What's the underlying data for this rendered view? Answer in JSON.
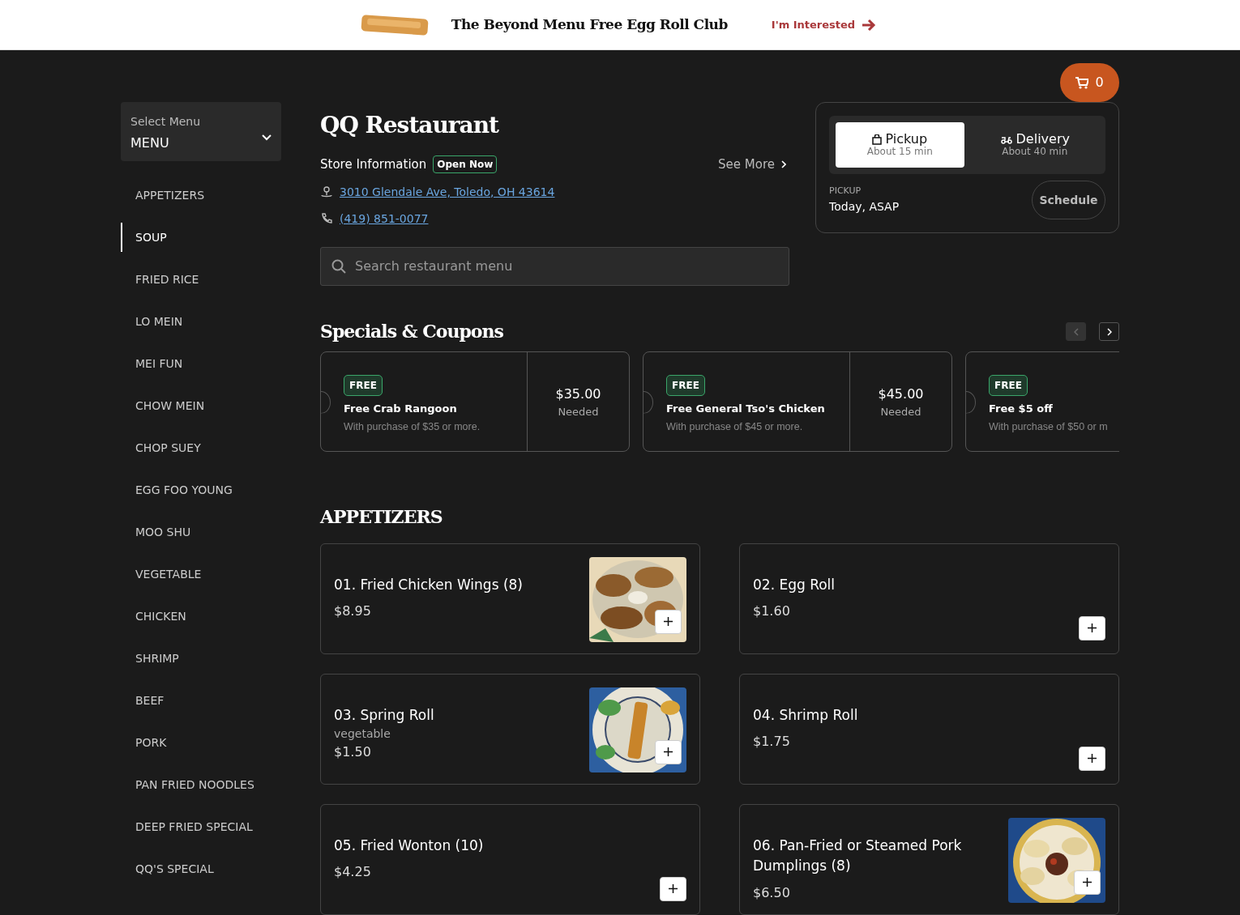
{
  "banner": {
    "title": "The Beyond Menu Free Egg Roll Club",
    "action": "I'm Interested"
  },
  "cart": {
    "count": "0"
  },
  "sidebar": {
    "select_label": "Select Menu",
    "select_value": "MENU",
    "items": [
      {
        "label": "APPETIZERS",
        "selected": false
      },
      {
        "label": "SOUP",
        "selected": true
      },
      {
        "label": "FRIED RICE",
        "selected": false
      },
      {
        "label": "LO MEIN",
        "selected": false
      },
      {
        "label": "MEI FUN",
        "selected": false
      },
      {
        "label": "CHOW MEIN",
        "selected": false
      },
      {
        "label": "CHOP SUEY",
        "selected": false
      },
      {
        "label": "EGG FOO YOUNG",
        "selected": false
      },
      {
        "label": "MOO SHU",
        "selected": false
      },
      {
        "label": "VEGETABLE",
        "selected": false
      },
      {
        "label": "CHICKEN",
        "selected": false
      },
      {
        "label": "SHRIMP",
        "selected": false
      },
      {
        "label": "BEEF",
        "selected": false
      },
      {
        "label": "PORK",
        "selected": false
      },
      {
        "label": "PAN FRIED NOODLES",
        "selected": false
      },
      {
        "label": "DEEP FRIED SPECIAL",
        "selected": false
      },
      {
        "label": "QQ'S SPECIAL",
        "selected": false
      }
    ]
  },
  "restaurant": {
    "name": "QQ Restaurant",
    "store_info": "Store Information",
    "status": "Open Now",
    "see_more": "See More",
    "address": "3010 Glendale Ave, Toledo, OH 43614",
    "phone": "(419) 851-0077"
  },
  "search": {
    "placeholder": "Search restaurant menu"
  },
  "order": {
    "modes": [
      {
        "kind": "pickup",
        "label": "Pickup",
        "time": "About 15 min",
        "selected": true
      },
      {
        "kind": "delivery",
        "label": "Delivery",
        "time": "About 40 min",
        "selected": false
      }
    ],
    "when_label": "PICKUP",
    "when": "Today, ASAP",
    "schedule": "Schedule"
  },
  "specials": {
    "title": "Specials & Coupons",
    "prev_disabled": true,
    "coupons": [
      {
        "tag": "FREE",
        "title": "Free Crab Rangoon",
        "desc": "With purchase of $35 or more.",
        "amount": "$35.00",
        "needed": "Needed"
      },
      {
        "tag": "FREE",
        "title": "Free General Tso's Chicken",
        "desc": "With purchase of $45 or more.",
        "amount": "$45.00",
        "needed": "Needed"
      },
      {
        "tag": "FREE",
        "title": "Free $5 off",
        "desc": "With purchase of $50 or m"
      }
    ]
  },
  "menu": {
    "title": "APPETIZERS",
    "items": [
      {
        "name": "01. Fried Chicken Wings (8)",
        "price": "$8.95"
      },
      {
        "name": "02. Egg Roll",
        "price": "$1.60"
      },
      {
        "name": "03. Spring Roll",
        "desc": "vegetable",
        "price": "$1.50"
      },
      {
        "name": "04. Shrimp Roll",
        "price": "$1.75"
      },
      {
        "name": "05. Fried Wonton (10)",
        "price": "$4.25"
      },
      {
        "name": "06. Pan-Fried or Steamed Pork Dumplings (8)",
        "price": "$6.50"
      }
    ]
  }
}
